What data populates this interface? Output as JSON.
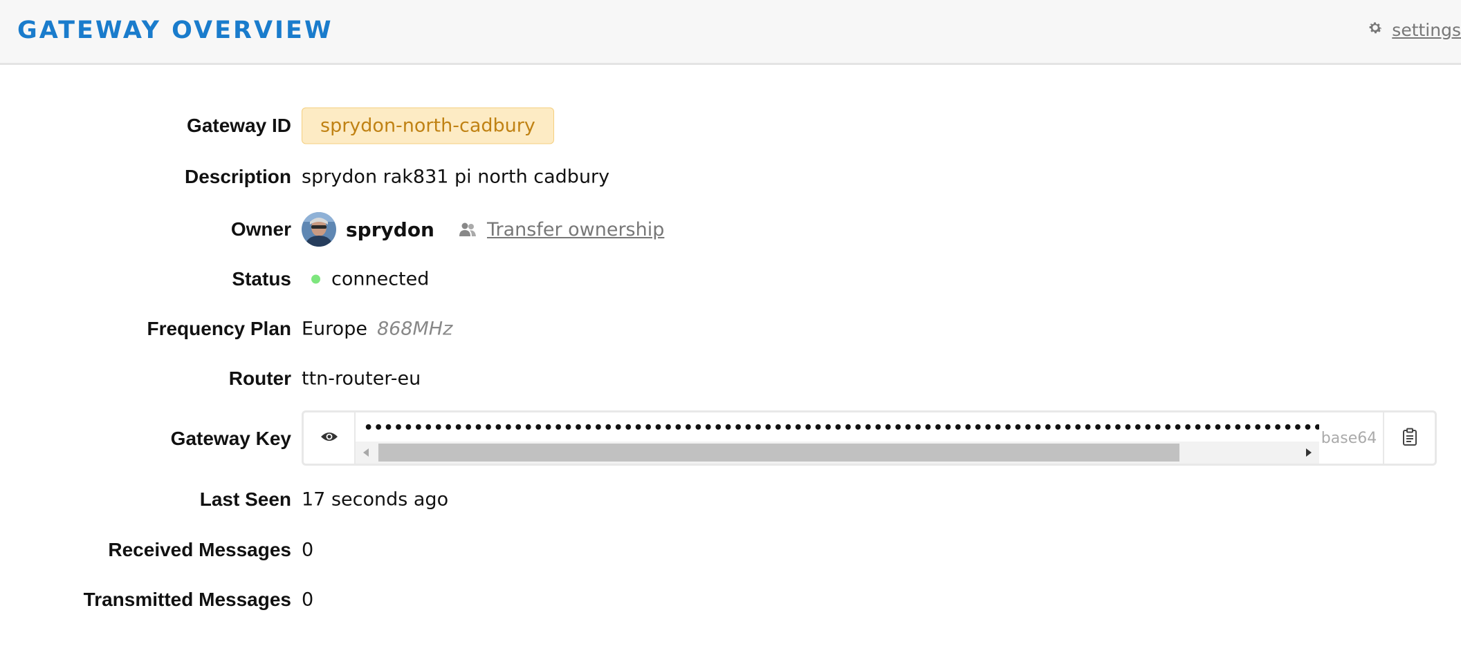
{
  "header": {
    "title": "GATEWAY OVERVIEW",
    "settings_label": "settings",
    "settings_icon": "gear-icon"
  },
  "fields": {
    "gateway_id": {
      "label": "Gateway ID",
      "value": "sprydon-north-cadbury"
    },
    "description": {
      "label": "Description",
      "value": "sprydon rak831 pi north cadbury"
    },
    "owner": {
      "label": "Owner",
      "name": "sprydon",
      "transfer_label": "Transfer ownership",
      "transfer_icon": "users-icon"
    },
    "status": {
      "label": "Status",
      "value": "connected",
      "color": "#7ee67e"
    },
    "frequency_plan": {
      "label": "Frequency Plan",
      "region": "Europe",
      "band": "868MHz"
    },
    "router": {
      "label": "Router",
      "value": "ttn-router-eu"
    },
    "gateway_key": {
      "label": "Gateway Key",
      "masked": "••••••••••••••••••••••••••••••••••••••••••••••••••••••••••••••••••••••••••••••••••••••••••••••••••••",
      "format": "base64",
      "show_icon": "eye-icon",
      "copy_icon": "clipboard-icon",
      "scroll_position": 0.0
    },
    "last_seen": {
      "label": "Last Seen",
      "value": "17 seconds ago"
    },
    "received_messages": {
      "label": "Received Messages",
      "value": "0"
    },
    "transmitted_messages": {
      "label": "Transmitted Messages",
      "value": "0"
    }
  },
  "colors": {
    "title": "#1a7ccc",
    "badge_bg": "#fdebc4",
    "badge_text": "#c08214"
  }
}
